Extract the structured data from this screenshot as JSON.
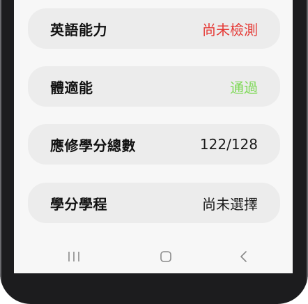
{
  "rows": [
    {
      "label": "英語能力",
      "value": "尚未檢測",
      "value_color": "#e53935"
    },
    {
      "label": "體適能",
      "value": "通過",
      "value_color": "#7ed957"
    },
    {
      "label": "應修學分總數",
      "value": "122/128",
      "value_color": "#1a1a1a"
    },
    {
      "label": "學分學程",
      "value": "尚未選擇",
      "value_color": "#1a1a1a"
    }
  ],
  "nav": {
    "recent_icon": "recent-apps-icon",
    "home_icon": "home-icon",
    "back_icon": "back-icon"
  }
}
